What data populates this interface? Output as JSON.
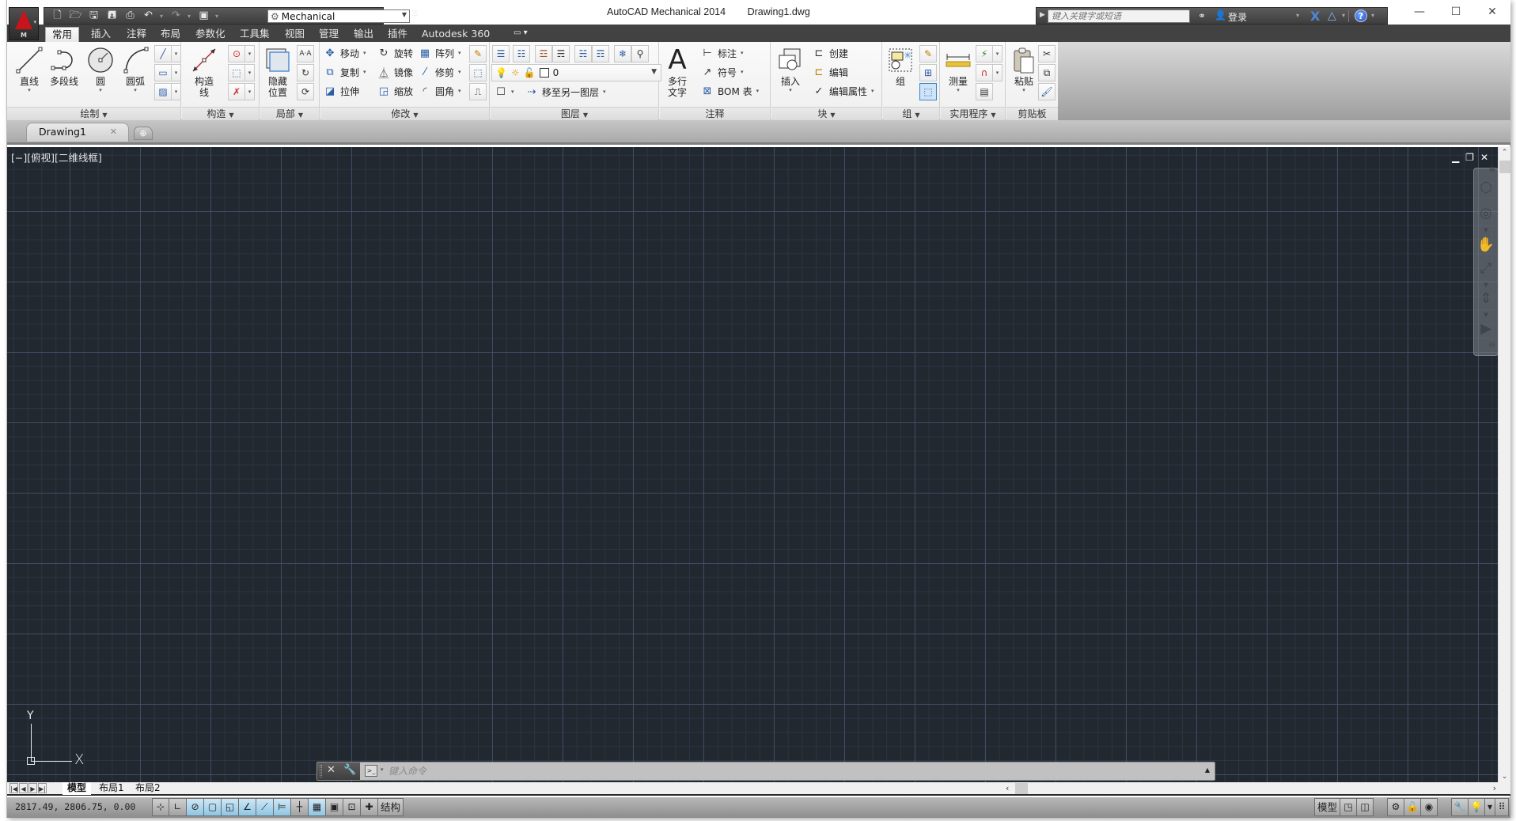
{
  "window": {
    "app_title": "AutoCAD Mechanical 2014",
    "doc_title": "Drawing1.dwg",
    "controls": {
      "minimize": "—",
      "maximize": "☐",
      "close": "✕"
    }
  },
  "app_button": {
    "letter": "M"
  },
  "quick_access": {
    "icons": [
      "new-icon",
      "open-icon",
      "save-icon",
      "save-as-icon",
      "print-icon",
      "undo-icon",
      "redo-icon",
      "plot-icon"
    ],
    "workspace": "Mechanical"
  },
  "infocenter": {
    "search_placeholder": "键入关键字或短语",
    "login_label": "登录"
  },
  "ribbon_tabs": [
    {
      "label": "常用",
      "active": true
    },
    {
      "label": "插入"
    },
    {
      "label": "注释"
    },
    {
      "label": "布局"
    },
    {
      "label": "参数化"
    },
    {
      "label": "工具集"
    },
    {
      "label": "视图"
    },
    {
      "label": "管理"
    },
    {
      "label": "输出"
    },
    {
      "label": "插件"
    },
    {
      "label": "Autodesk 360"
    }
  ],
  "ribbon": {
    "draw": {
      "title": "绘制",
      "line": "直线",
      "polyline": "多段线",
      "circle": "圆",
      "arc": "圆弧"
    },
    "construct": {
      "title": "构造",
      "xline_1": "构造",
      "xline_2": "线"
    },
    "local": {
      "title": "局部",
      "hide_1": "隐藏",
      "hide_2": "位置"
    },
    "modify": {
      "title": "修改",
      "move": "移动",
      "rotate": "旋转",
      "array": "阵列",
      "copy": "复制",
      "mirror": "镜像",
      "trim": "修剪",
      "stretch": "拉伸",
      "scale": "缩放",
      "fillet": "圆角"
    },
    "layers": {
      "title": "图层",
      "current_layer": "0",
      "move_to_layer": "移至另一图层"
    },
    "annotation": {
      "title": "注释",
      "mtext_1": "多行",
      "mtext_2": "文字",
      "dimension": "标注",
      "symbol": "符号",
      "bom": "BOM 表"
    },
    "block": {
      "title": "块",
      "insert": "插入",
      "create": "创建",
      "edit": "编辑",
      "edit_attr": "编辑属性"
    },
    "group": {
      "title": "组",
      "group": "组"
    },
    "utilities": {
      "title": "实用程序",
      "measure": "测量"
    },
    "clipboard": {
      "title": "剪贴板",
      "paste": "粘贴"
    }
  },
  "doc_tabs": [
    {
      "label": "Drawing1",
      "active": true
    }
  ],
  "viewport": {
    "label": "[−][俯视][二维线框]",
    "ucs_x": "X",
    "ucs_y": "Y"
  },
  "command_line": {
    "placeholder": "键入命令"
  },
  "layout_tabs": [
    {
      "label": "模型",
      "active": true
    },
    {
      "label": "布局1"
    },
    {
      "label": "布局2"
    }
  ],
  "status_bar": {
    "coordinates": "2817.49, 2806.75, 0.00",
    "structure_label": "结构",
    "model_label": "模型"
  },
  "colors": {
    "viewport_bg": "#212830",
    "ribbon_tab_bg": "#424242",
    "accent_red": "#c8141a",
    "toggle_on": "#8ec5e4"
  }
}
